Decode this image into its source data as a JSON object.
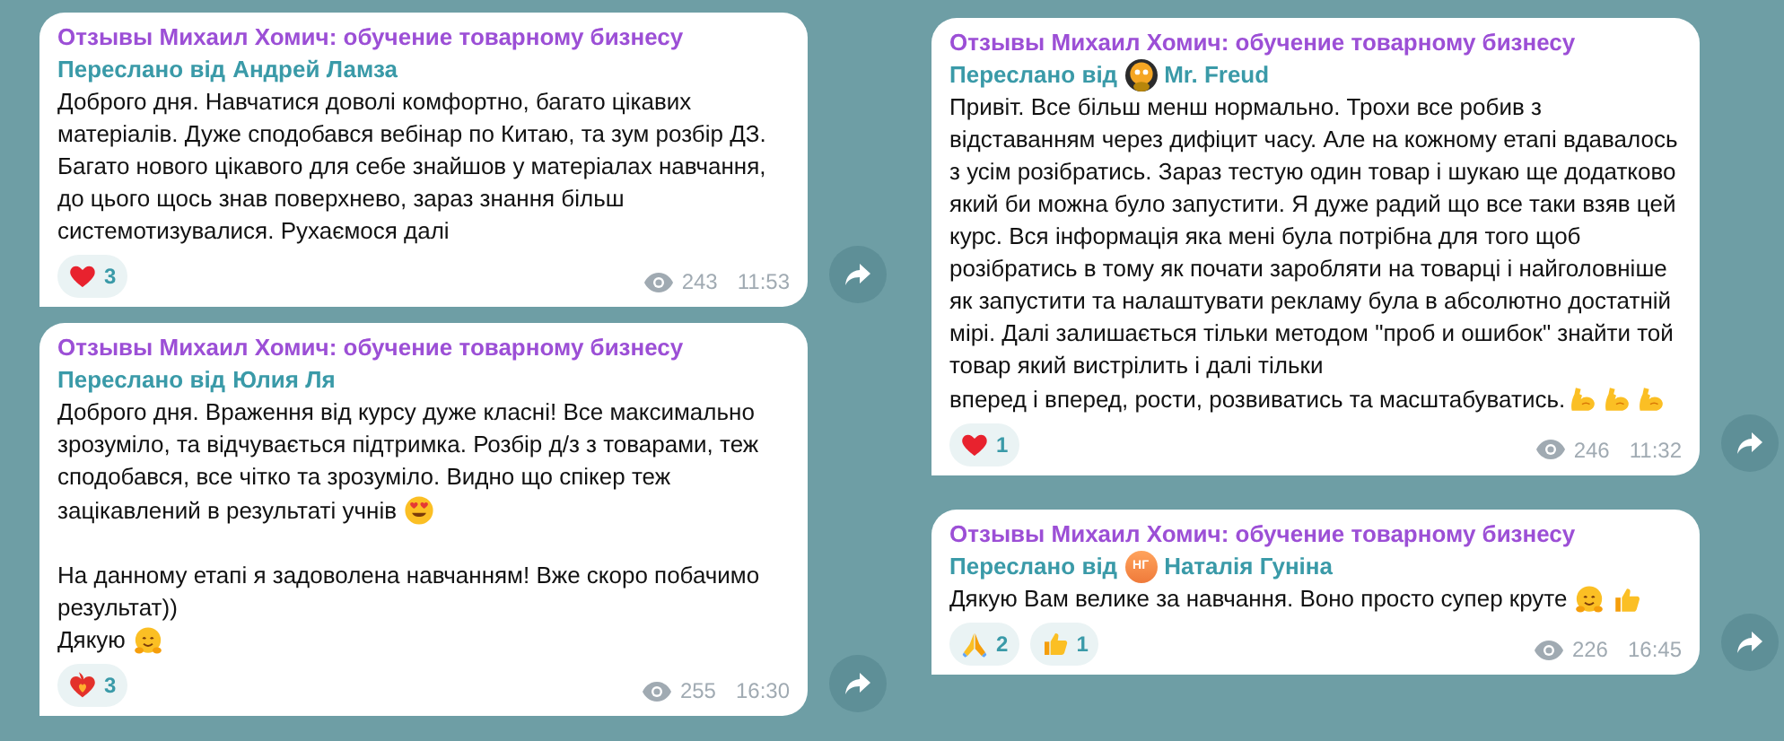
{
  "columns": [
    {
      "messages": [
        {
          "channel": "Отзывы Михаил Хомич: обучение товарному бизнесу",
          "forwarded_label": "Переслано від",
          "forwarded_from": "Андрей Ламза",
          "paragraphs": [
            [
              {
                "kind": "text",
                "text": "Доброго дня. Навчатися доволі комфортно, багато цікавих матеріалів. Дуже сподобався вебінар по Китаю, та зум розбір ДЗ. Багато нового цікавого для себе знайшов у матеріалах навчання, до цього щось знав поверхнево, зараз знання більш системотизувалися. Рухаємося далі"
              }
            ]
          ],
          "reactions": [
            {
              "kind": "heart",
              "count": "3"
            }
          ],
          "views": "243",
          "time": "11:53"
        },
        {
          "channel": "Отзывы Михаил Хомич: обучение товарному бизнесу",
          "forwarded_label": "Переслано від",
          "forwarded_from": "Юлия Ля",
          "paragraphs": [
            [
              {
                "kind": "text",
                "text": "Доброго дня. Враження від курсу дуже класні! Все максимально зрозуміло, та відчувається підтримка. Розбір д/з з товарами, теж сподобався, все чітко та зрозуміло. Видно що спікер теж"
              },
              {
                "kind": "text",
                "text": "зацікавлений в результаті учнів"
              },
              {
                "kind": "heart-eyes"
              }
            ],
            [
              {
                "kind": "text",
                "text": "На данному етапі я задоволена навчанням! Вже скоро побачимо результат))"
              }
            ],
            [
              {
                "kind": "text",
                "text": "Дякую"
              },
              {
                "kind": "hug"
              }
            ]
          ],
          "reactions": [
            {
              "kind": "heart-fire",
              "count": "3"
            }
          ],
          "views": "255",
          "time": "16:30"
        }
      ]
    },
    {
      "messages": [
        {
          "channel": "Отзывы Михаил Хомич: обучение товарному бизнесу",
          "forwarded_label": "Переслано від",
          "forwarded_from": "Mr. Freud",
          "avatar": {
            "kind": "picture"
          },
          "paragraphs": [
            [
              {
                "kind": "text",
                "text": "Привіт. Все більш менш нормально. Трохи все робив з відставанням через дифіцит часу. Але на кожному етапі вдавалось з усім розібратись. Зараз тестую один товар і шукаю ще додатково який би можна було запустити. Я дуже радий що все таки взяв цей курс. Вся інформація яка мені була потрібна для того щоб розібратись в тому як почати заробляти на товарці і найголовніше як запустити та налаштувати рекламу була в абсолютно достатній мірі. Далі залишається тільки методом \"проб и ошибок\" знайти той товар який вистрілить і далі тільки"
              },
              {
                "kind": "text",
                "text": "вперед і вперед, рости, розвиватись та масштабуватись."
              },
              {
                "kind": "flex"
              },
              {
                "kind": "flex"
              },
              {
                "kind": "flex"
              }
            ]
          ],
          "reactions": [
            {
              "kind": "heart",
              "count": "1"
            }
          ],
          "views": "246",
          "time": "11:32"
        },
        {
          "channel": "Отзывы Михаил Хомич: обучение товарному бизнесу",
          "forwarded_label": "Переслано від",
          "forwarded_from": "Наталія Гуніна",
          "avatar": {
            "kind": "initials",
            "initials": "НГ"
          },
          "paragraphs": [
            [
              {
                "kind": "text",
                "text": "Дякую  Вам велике за навчання.  Воно просто супер круте"
              },
              {
                "kind": "hug"
              },
              {
                "kind": "thumbs-up"
              }
            ]
          ],
          "reactions": [
            {
              "kind": "pray",
              "count": "2"
            },
            {
              "kind": "thumbs-up",
              "count": "1"
            }
          ],
          "views": "226",
          "time": "16:45"
        }
      ]
    }
  ]
}
